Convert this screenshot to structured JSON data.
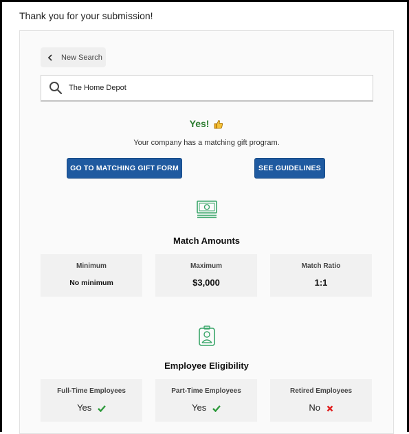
{
  "page": {
    "thanks_message": "Thank you for your submission!"
  },
  "search": {
    "back_label": "New Search",
    "company_value": "The Home Depot"
  },
  "result": {
    "yes_label": "Yes!",
    "message": "Your company has a matching gift program.",
    "form_button": "GO TO MATCHING GIFT FORM",
    "guidelines_button": "SEE GUIDELINES"
  },
  "match_amounts": {
    "title": "Match Amounts",
    "minimum_label": "Minimum",
    "minimum_value": "No minimum",
    "maximum_label": "Maximum",
    "maximum_value": "$3,000",
    "ratio_label": "Match Ratio",
    "ratio_value": "1:1"
  },
  "eligibility": {
    "title": "Employee Eligibility",
    "full_time_label": "Full-Time Employees",
    "full_time_value": "Yes",
    "part_time_label": "Part-Time Employees",
    "part_time_value": "Yes",
    "retired_label": "Retired Employees",
    "retired_value": "No"
  },
  "colors": {
    "button_blue": "#1f5aa0",
    "yes_green": "#2e7d32",
    "icon_green": "#3aa66a",
    "no_red": "#e02020"
  },
  "icons": {
    "back": "chevron-left-icon",
    "search": "search-icon",
    "thumb": "thumbs-up-icon",
    "money": "money-icon",
    "badge": "employee-badge-icon",
    "yes": "check-icon",
    "no": "x-icon"
  }
}
